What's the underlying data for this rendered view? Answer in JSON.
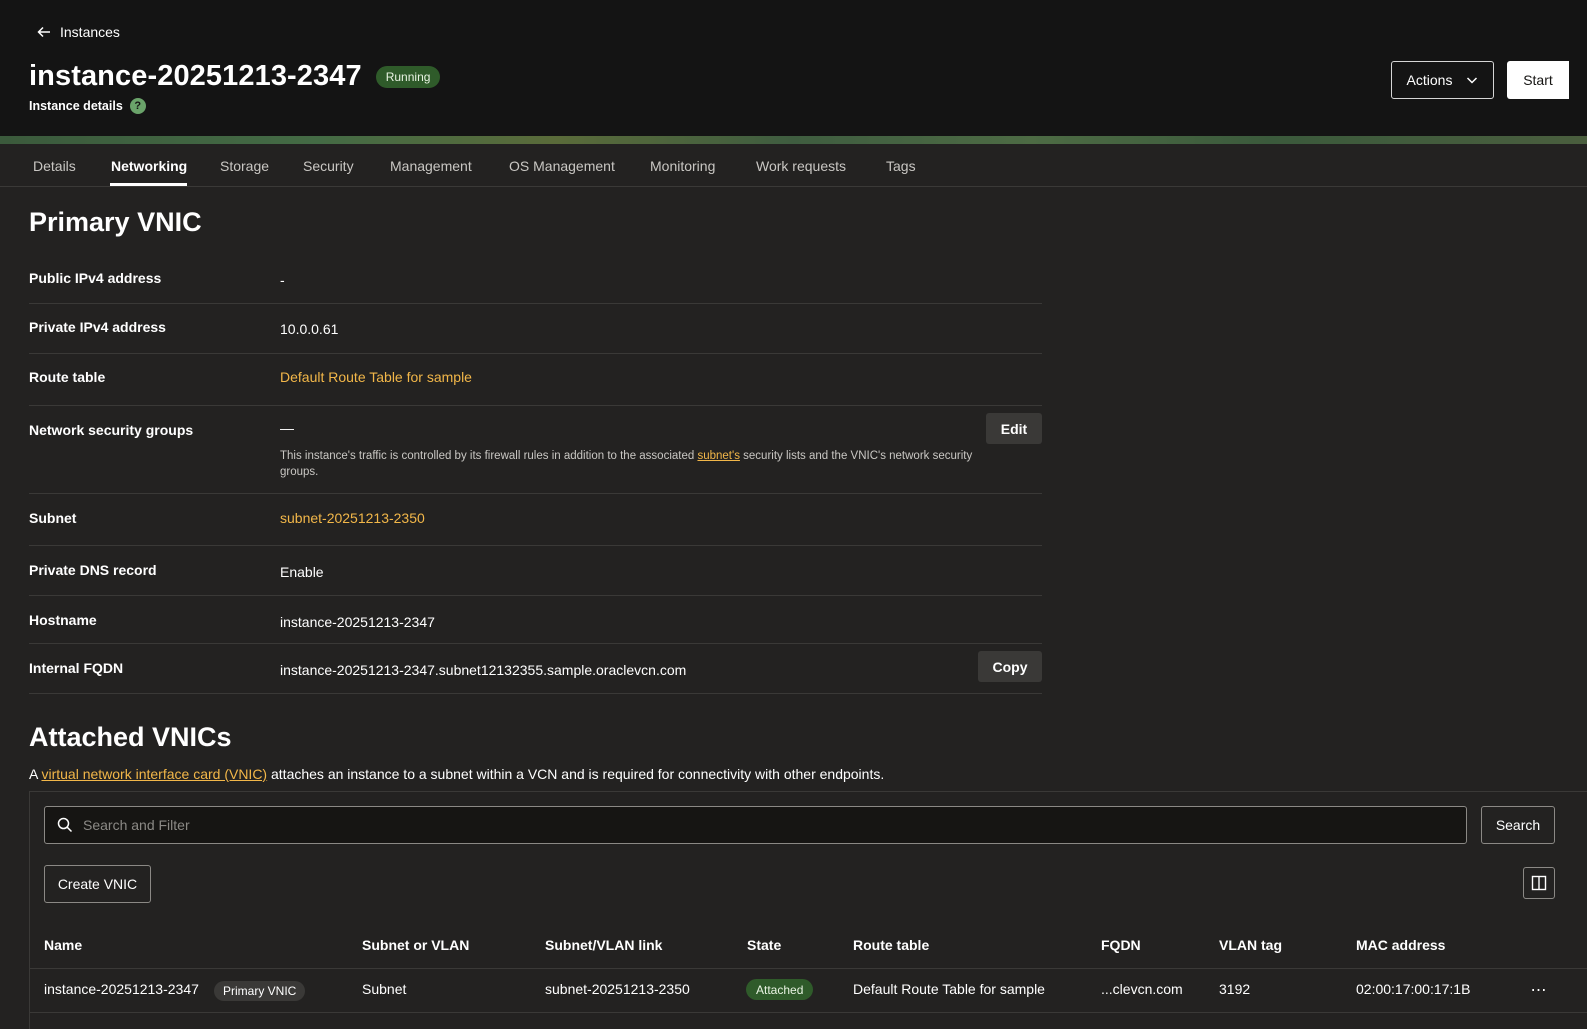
{
  "header": {
    "back_label": "Instances",
    "title": "instance-20251213-2347",
    "status": "Running",
    "subtitle": "Instance details",
    "help_glyph": "?",
    "actions_label": "Actions",
    "start_label": "Start"
  },
  "tabs": [
    {
      "label": "Details"
    },
    {
      "label": "Networking",
      "active": true
    },
    {
      "label": "Storage"
    },
    {
      "label": "Security"
    },
    {
      "label": "Management"
    },
    {
      "label": "OS Management"
    },
    {
      "label": "Monitoring"
    },
    {
      "label": "Work requests"
    },
    {
      "label": "Tags"
    }
  ],
  "primary_vnic": {
    "title": "Primary VNIC",
    "public_ipv4": {
      "label": "Public IPv4 address",
      "value": "-"
    },
    "private_ipv4": {
      "label": "Private IPv4 address",
      "value": "10.0.0.61"
    },
    "route_table": {
      "label": "Route table",
      "value": "Default Route Table for sample"
    },
    "nsg": {
      "label": "Network security groups",
      "value": "—",
      "edit_label": "Edit",
      "note_before": "This instance's traffic is controlled by its firewall rules in addition to the associated ",
      "note_link": "subnet's",
      "note_after": " security lists and the VNIC's network security groups."
    },
    "subnet": {
      "label": "Subnet",
      "value": "subnet-20251213-2350"
    },
    "private_dns": {
      "label": "Private DNS record",
      "value": "Enable"
    },
    "hostname": {
      "label": "Hostname",
      "value": "instance-20251213-2347"
    },
    "fqdn": {
      "label": "Internal FQDN",
      "value": "instance-20251213-2347.subnet12132355.sample.oraclevcn.com",
      "copy_label": "Copy"
    }
  },
  "attached_vnics": {
    "title": "Attached VNICs",
    "desc_before": "A ",
    "desc_link": "virtual network interface card (VNIC)",
    "desc_after": " attaches an instance to a subnet within a VCN and is required for connectivity with other endpoints.",
    "search_placeholder": "Search and Filter",
    "search_label": "Search",
    "create_label": "Create VNIC",
    "columns": [
      "Name",
      "Subnet or VLAN",
      "Subnet/VLAN link",
      "State",
      "Route table",
      "FQDN",
      "VLAN tag",
      "MAC address"
    ],
    "rows": [
      {
        "name": "instance-20251213-2347",
        "badge": "Primary VNIC",
        "subnet_or_vlan": "Subnet",
        "link": "subnet-20251213-2350",
        "state": "Attached",
        "route_table": "Default Route Table for sample",
        "fqdn": "...clevcn.com",
        "vlan_tag": "3192",
        "mac": "02:00:17:00:17:1B",
        "menu": "⋯"
      }
    ]
  },
  "colors": {
    "background": "#232221",
    "header": "#141414",
    "link": "#f2b749",
    "success_badge": "#2f5b2a"
  }
}
